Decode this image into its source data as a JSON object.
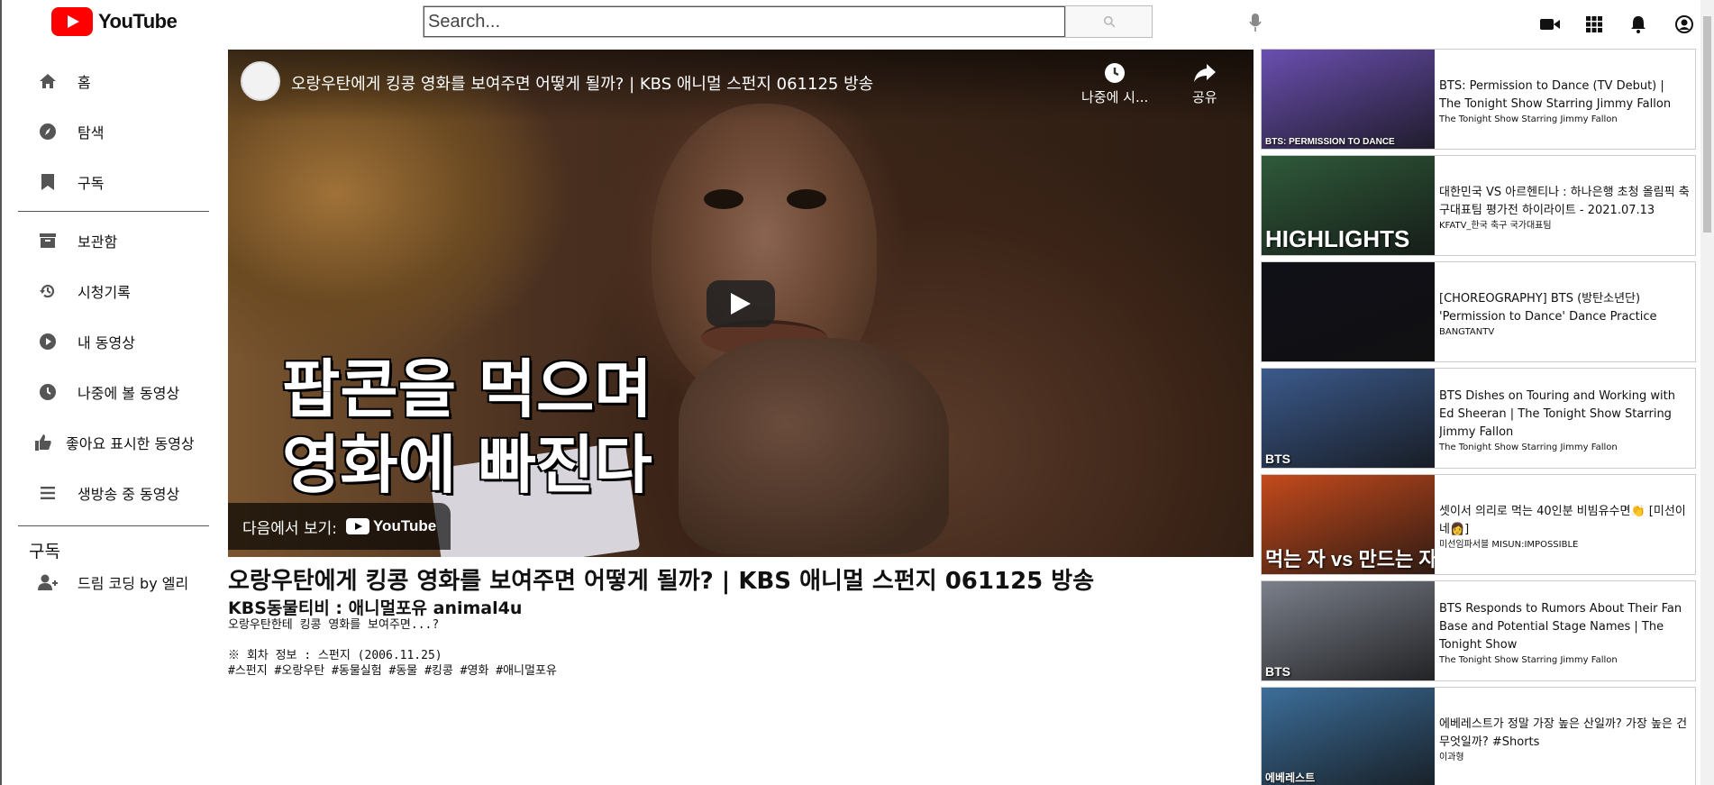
{
  "header": {
    "logo_text": "YouTube",
    "search_placeholder": "Search...",
    "icons": [
      "video-camera-icon",
      "apps-grid-icon",
      "bell-icon",
      "account-icon"
    ]
  },
  "sidebar": {
    "items": [
      {
        "label": "홈",
        "icon": "home-icon"
      },
      {
        "label": "탐색",
        "icon": "compass-icon"
      },
      {
        "label": "구독",
        "icon": "bookmark-icon"
      },
      {
        "label": "보관함",
        "icon": "library-icon"
      },
      {
        "label": "시청기록",
        "icon": "history-icon"
      },
      {
        "label": "내 동영상",
        "icon": "play-circle-icon"
      },
      {
        "label": "나중에 볼 동영상",
        "icon": "clock-icon"
      },
      {
        "label": "좋아요 표시한 동영상",
        "icon": "thumbs-up-icon"
      },
      {
        "label": "생방송 중 동영상",
        "icon": "list-icon"
      }
    ],
    "subscriptions_title": "구독",
    "subscriptions": [
      {
        "label": "드림 코딩 by 엘리",
        "icon": "user-plus-icon"
      }
    ]
  },
  "player": {
    "title": "오랑우탄에게 킹콩 영화를 보여주면 어떻게 될까? | KBS 애니멀 스펀지 061125 방송",
    "watch_later_label": "나중에 시...",
    "share_label": "공유",
    "burned_subtitle_line1": "팝콘을 먹으며",
    "burned_subtitle_line2": "영화에 빠진다",
    "watch_on_label": "다음에서 보기:",
    "watch_on_brand": "YouTube"
  },
  "video": {
    "title": "오랑우탄에게 킹콩 영화를 보여주면 어떻게 될까? | KBS 애니멀 스펀지 061125 방송",
    "channel": "KBS동물티비 : 애니멀포유 animal4u",
    "description": "오랑우탄한테 킹콩 영화를 보여주면...?\n\n※ 회차 정보 : 스펀지 (2006.11.25)\n#스펀지 #오랑우탄 #동물실험 #동물 #킹콩 #영화 #애니멀포유"
  },
  "related": [
    {
      "title": "BTS: Permission to Dance (TV Debut) | The Tonight Show Starring Jimmy Fallon",
      "channel": "The Tonight Show Starring Jimmy Fallon",
      "thumb_caption": "BTS: PERMISSION TO DANCE",
      "thumb_color": "#6a4fb0"
    },
    {
      "title": "대한민국 VS 아르헨티나 : 하나은행 초청 올림픽 축구대표팀 평가전 하이라이트 - 2021.07.13",
      "channel": "KFATV_한국 축구 국가대표팀",
      "thumb_caption": "HIGHLIGHTS",
      "thumb_color": "#2f5a3a"
    },
    {
      "title": "[CHOREOGRAPHY] BTS (방탄소년단) 'Permission to Dance' Dance Practice",
      "channel": "BANGTANTV",
      "thumb_caption": "",
      "thumb_color": "#101018"
    },
    {
      "title": "BTS Dishes on Touring and Working with Ed Sheeran | The Tonight Show Starring Jimmy Fallon",
      "channel": "The Tonight Show Starring Jimmy Fallon",
      "thumb_caption": "BTS",
      "thumb_color": "#3b5a8c"
    },
    {
      "title": "셋이서 의리로 먹는 40인분 비빔유수면👏 [미선이네👩]",
      "channel": "미선임파서블 MISUN:IMPOSSIBLE",
      "thumb_caption": "먹는 자 vs 만드는 자",
      "thumb_color": "#c44a1c"
    },
    {
      "title": "BTS Responds to Rumors About Their Fan Base and Potential Stage Names | The Tonight Show",
      "channel": "The Tonight Show Starring Jimmy Fallon",
      "thumb_caption": "BTS",
      "thumb_color": "#7a7f8a"
    },
    {
      "title": "에베레스트가 정말 가장 높은 산일까? 가장 높은 건 무엇일까? #Shorts",
      "channel": "이과형",
      "thumb_caption": "에베레스트",
      "thumb_color": "#3c6e9a"
    }
  ]
}
